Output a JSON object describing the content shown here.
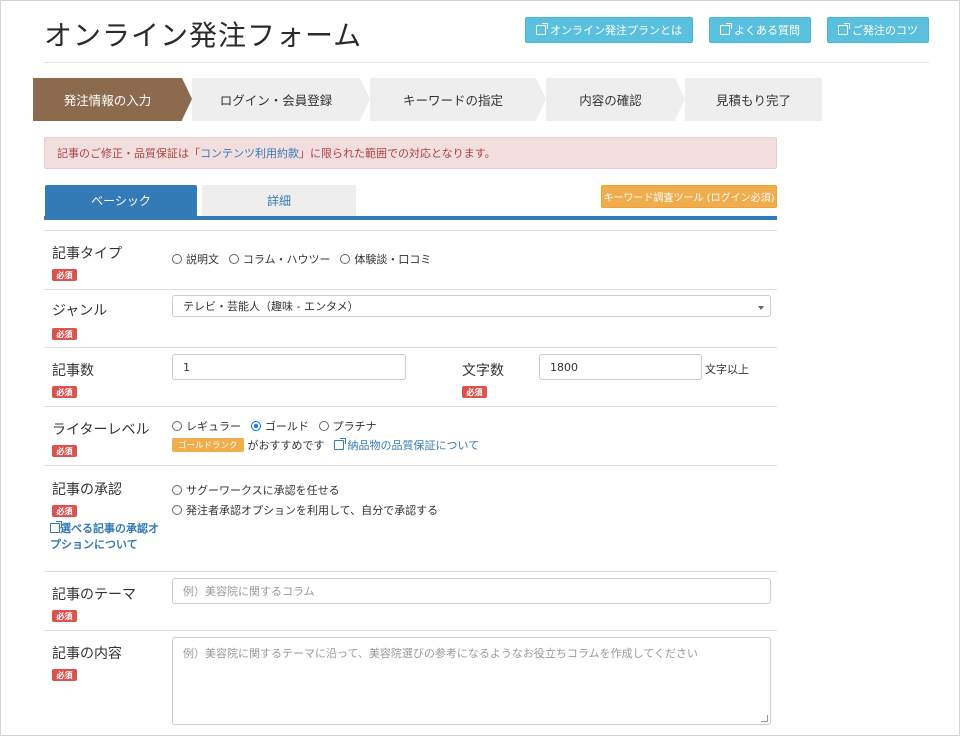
{
  "header": {
    "title": "オンライン発注フォーム",
    "links": [
      {
        "label": "オンライン発注プランとは",
        "icon": "external-link-icon"
      },
      {
        "label": "よくある質問",
        "icon": "external-link-icon"
      },
      {
        "label": "ご発注のコツ",
        "icon": "external-link-icon"
      }
    ]
  },
  "steps": [
    {
      "label": "発注情報の入力",
      "active": true
    },
    {
      "label": "ログイン・会員登録",
      "active": false
    },
    {
      "label": "キーワードの指定",
      "active": false
    },
    {
      "label": "内容の確認",
      "active": false
    },
    {
      "label": "見積もり完了",
      "active": false
    }
  ],
  "alert": {
    "prefix": "記事のご修正・品質保証は「",
    "link": "コンテンツ利用約款",
    "suffix": "」に限られた範囲での対応となります。"
  },
  "tabs": {
    "basic": "ベーシック",
    "detail": "詳細",
    "keyword_tool": "キーワード調査ツール (ログイン必須)"
  },
  "required_label": "必須",
  "form": {
    "article_type": {
      "label": "記事タイプ",
      "options": [
        "説明文",
        "コラム・ハウツー",
        "体験談・口コミ"
      ]
    },
    "genre": {
      "label": "ジャンル",
      "value": "テレビ・芸能人（趣味 - エンタメ）"
    },
    "article_count": {
      "label": "記事数",
      "value": "1"
    },
    "char_count": {
      "label": "文字数",
      "value": "1800",
      "unit": "文字以上"
    },
    "writer_level": {
      "label": "ライターレベル",
      "options": [
        "レギュラー",
        "ゴールド",
        "プラチナ"
      ],
      "selected": "ゴールド",
      "badge": "ゴールドランク",
      "recommend": "がおすすめです",
      "quality_link": "納品物の品質保証について"
    },
    "approval": {
      "label": "記事の承認",
      "options": [
        "サグーワークスに承認を任せる",
        "発注者承認オプションを利用して、自分で承認する"
      ],
      "side_link": "選べる記事の承認オプションについて"
    },
    "theme": {
      "label": "記事のテーマ",
      "placeholder": "例）美容院に関するコラム"
    },
    "content": {
      "label": "記事の内容",
      "placeholder": "例）美容院に関するテーマに沿って、美容院選びの参考になるようなお役立ちコラムを作成してください"
    }
  },
  "colors": {
    "primary": "#337ab7",
    "info": "#5bc0de",
    "warning": "#f0ad4e",
    "danger": "#d9534f",
    "step_active": "#8b6a4e"
  }
}
